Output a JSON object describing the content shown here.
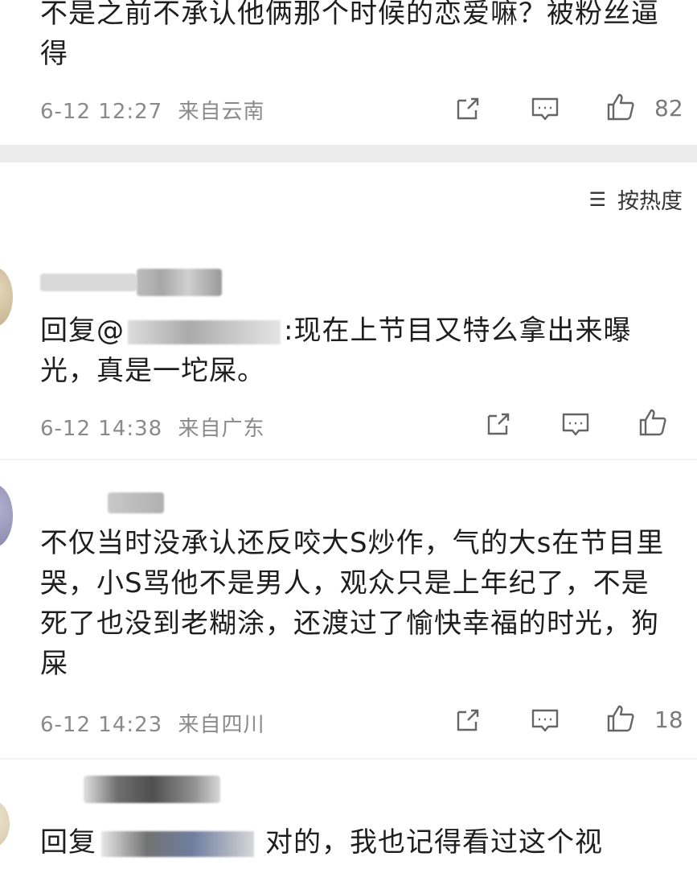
{
  "comments": [
    {
      "text": "不是之前不承认他俩那个时候的恋爱嘛？被粉丝逼得",
      "date": "6-12 12:27",
      "location": "来自云南",
      "likes": "82"
    },
    {
      "reply_prefix": "回复@",
      "text": ":现在上节目又特么拿出来曝光，真是一坨屎。",
      "date": "6-12 14:38",
      "location": "来自广东",
      "likes": ""
    },
    {
      "text": "不仅当时没承认还反咬大S炒作，气的大s在节目里哭，小S骂他不是男人，观众只是上年纪了，不是死了也没到老糊涂，还渡过了愉快幸福的时光，狗屎",
      "date": "6-12 14:23",
      "location": "来自四川",
      "likes": "18"
    },
    {
      "reply_prefix": "回复",
      "text": "对的，我也记得看过这个视"
    }
  ],
  "sort": {
    "label": "按热度",
    "icon": "sort-icon"
  },
  "icons": {
    "share": "share-icon",
    "comment": "comment-icon",
    "like": "like-icon"
  },
  "colors": {
    "background": "#ffffff",
    "separator": "#ececec",
    "meta": "#8a8a8a",
    "text": "#1e1e1e"
  }
}
